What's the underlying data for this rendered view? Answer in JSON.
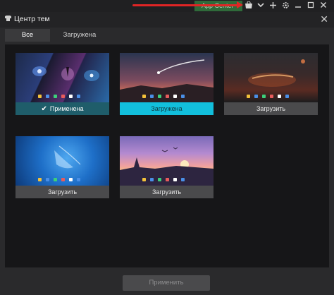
{
  "host_toolbar": {
    "app_center_label": "App Center",
    "icons": [
      "store-icon",
      "chevron-down-icon",
      "pin-icon",
      "gear-icon",
      "minimize-icon",
      "maximize-icon",
      "close-icon"
    ],
    "arrow_color": "#e02525"
  },
  "dialog": {
    "title": "Центр тем",
    "close_icon": "close-icon"
  },
  "tabs": [
    {
      "label": "Все",
      "active": true
    },
    {
      "label": "Загружена",
      "active": false
    }
  ],
  "themes": [
    {
      "status": "applied",
      "label": "Применена"
    },
    {
      "status": "loaded",
      "label": "Загружена"
    },
    {
      "status": "download",
      "label": "Загрузить"
    },
    {
      "status": "download",
      "label": "Загрузить"
    },
    {
      "status": "download",
      "label": "Загрузить"
    }
  ],
  "footer": {
    "apply_label": "Применить"
  },
  "colors": {
    "accent_applied": "#1f5d6a",
    "accent_loaded": "#12bfdc",
    "download_bar": "#4a4a4c"
  }
}
